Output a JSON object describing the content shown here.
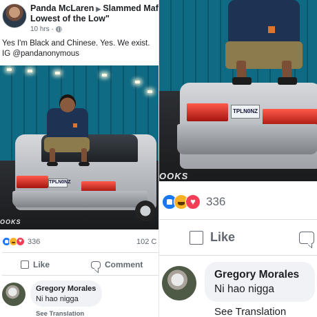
{
  "post": {
    "poster_name": "Panda McLaren",
    "group_name": "Slammed Maf",
    "group_name_line2": "Lowest of the Low\"",
    "time": "10 hrs",
    "meta_sep": "·",
    "text_line1": "Yes I'm Black and Chinese. Yes. We exist.",
    "text_line2": "IG @pandanonymous"
  },
  "photo": {
    "plate_text": "TPLN0NZ",
    "watermark": "OOKS"
  },
  "reactions": {
    "count": "336",
    "comments_count": "102 C",
    "types": [
      "like",
      "haha",
      "love"
    ]
  },
  "actions": {
    "like_label": "Like",
    "comment_label": "Comment"
  },
  "comment": {
    "author": "Gregory Morales",
    "text": "Ni hao nigga",
    "see_translation": "See Translation"
  },
  "icons": [
    "globe-icon",
    "like-icon",
    "comment-icon",
    "like-reaction-icon",
    "haha-reaction-icon",
    "love-reaction-icon"
  ],
  "colors": {
    "accent": "#1877f2",
    "love": "#f33e58",
    "haha": "#f7b125",
    "muted": "#606770"
  }
}
